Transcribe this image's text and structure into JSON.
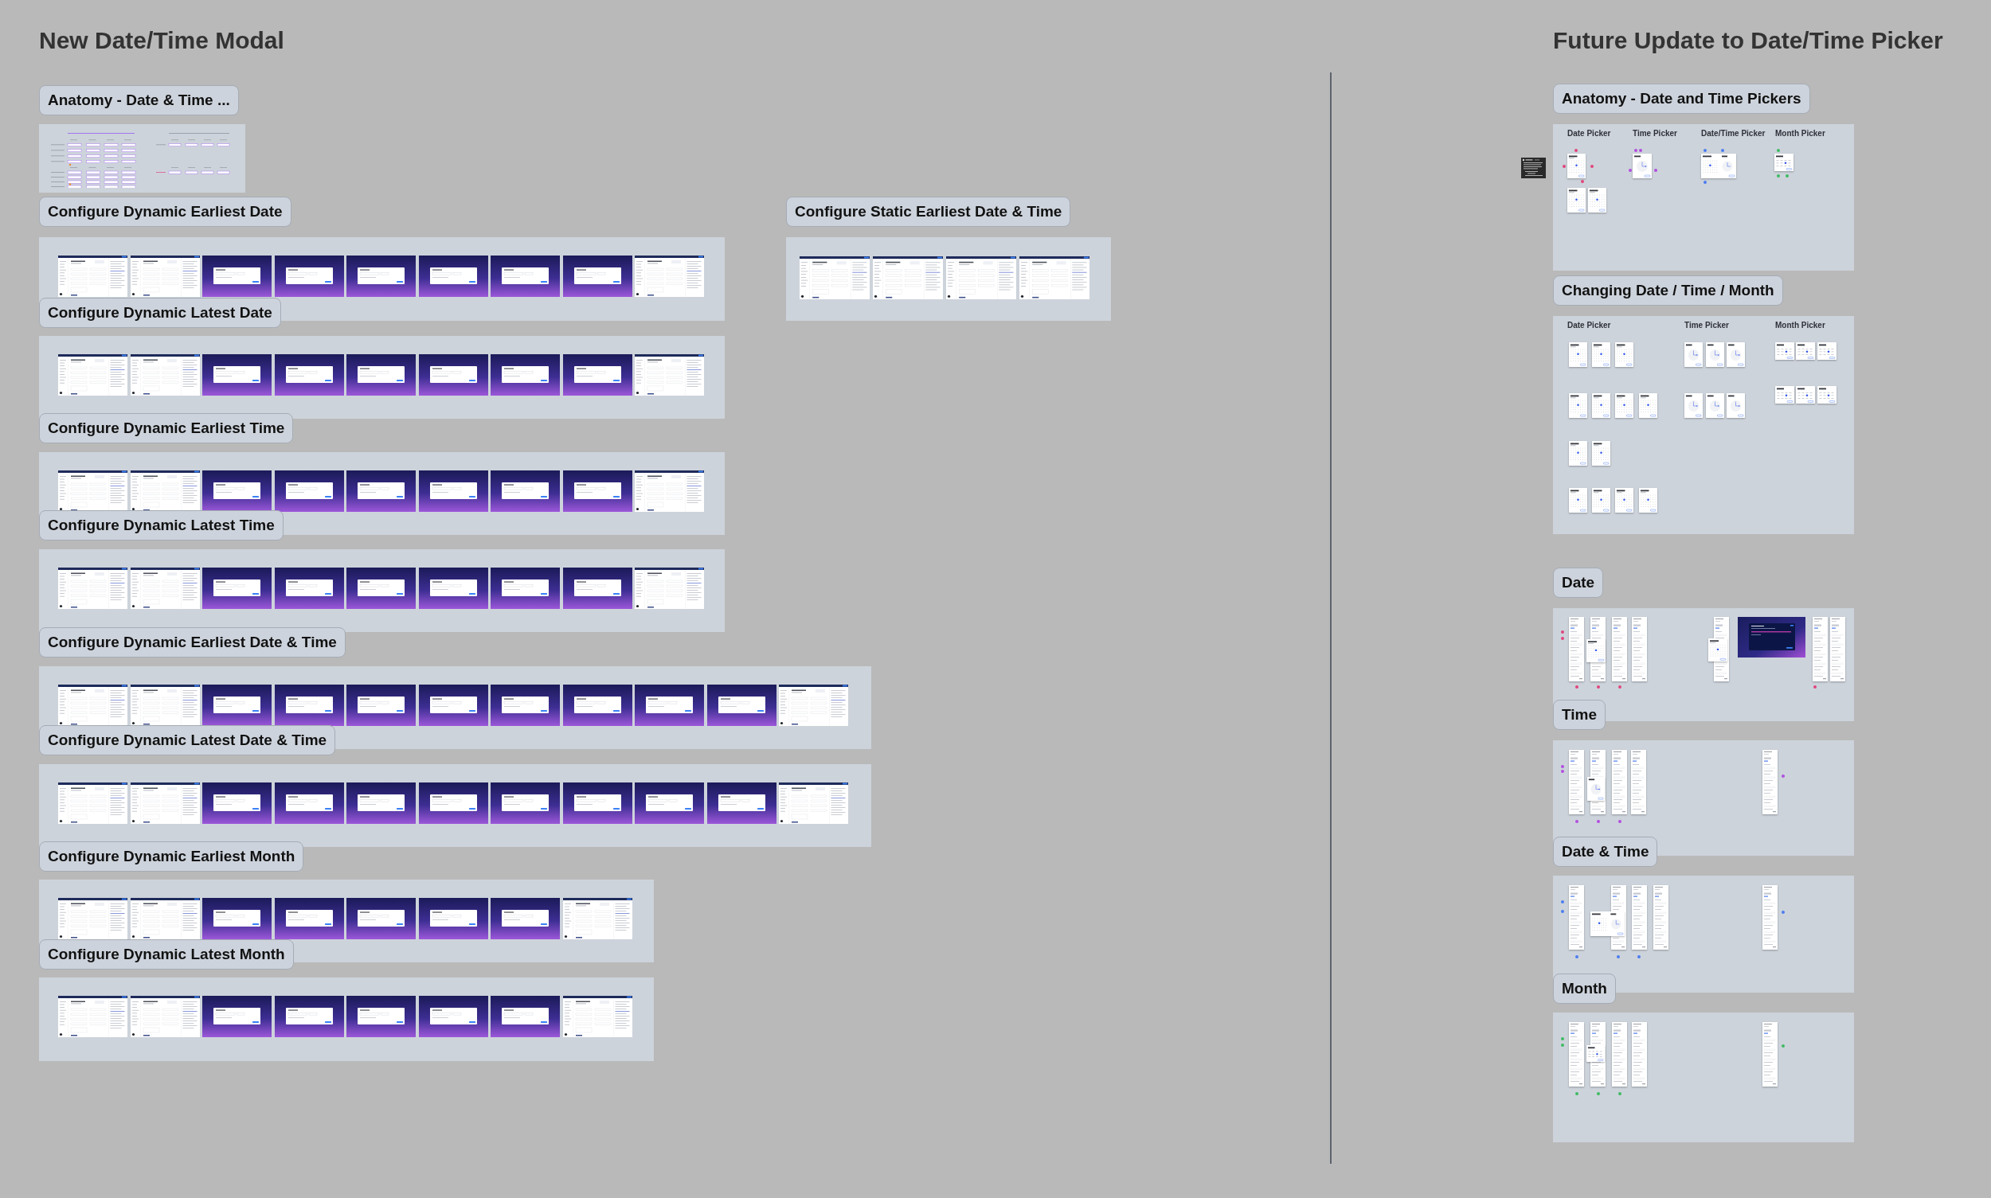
{
  "canvas": {
    "left": {
      "title": "New Date/Time Modal",
      "sections": [
        {
          "label": "Anatomy - Date & Time ...",
          "kind": "anatomy"
        },
        {
          "label": "Configure Dynamic Earliest Date",
          "kind": "screens",
          "screens": [
            {
              "kind": "page"
            },
            {
              "kind": "page"
            },
            {
              "kind": "modal"
            },
            {
              "kind": "modal"
            },
            {
              "kind": "modal"
            },
            {
              "kind": "modal"
            },
            {
              "kind": "modal"
            },
            {
              "kind": "modal"
            },
            {
              "kind": "page"
            }
          ]
        },
        {
          "label": "Configure Dynamic Latest Date",
          "kind": "screens",
          "screens": [
            {
              "kind": "page"
            },
            {
              "kind": "page"
            },
            {
              "kind": "modal"
            },
            {
              "kind": "modal"
            },
            {
              "kind": "modal"
            },
            {
              "kind": "modal"
            },
            {
              "kind": "modal"
            },
            {
              "kind": "modal"
            },
            {
              "kind": "page"
            }
          ]
        },
        {
          "label": "Configure Dynamic Earliest Time",
          "kind": "screens",
          "screens": [
            {
              "kind": "page"
            },
            {
              "kind": "page"
            },
            {
              "kind": "modal"
            },
            {
              "kind": "modal"
            },
            {
              "kind": "modal"
            },
            {
              "kind": "modal"
            },
            {
              "kind": "modal"
            },
            {
              "kind": "modal"
            },
            {
              "kind": "page"
            }
          ]
        },
        {
          "label": "Configure Dynamic Latest Time",
          "kind": "screens",
          "screens": [
            {
              "kind": "page"
            },
            {
              "kind": "page"
            },
            {
              "kind": "modal"
            },
            {
              "kind": "modal"
            },
            {
              "kind": "modal"
            },
            {
              "kind": "modal"
            },
            {
              "kind": "modal"
            },
            {
              "kind": "modal"
            },
            {
              "kind": "page"
            }
          ]
        },
        {
          "label": "Configure Dynamic Earliest Date & Time",
          "kind": "screens",
          "screens": [
            {
              "kind": "page"
            },
            {
              "kind": "page"
            },
            {
              "kind": "modal"
            },
            {
              "kind": "modal"
            },
            {
              "kind": "modal"
            },
            {
              "kind": "modal"
            },
            {
              "kind": "modal"
            },
            {
              "kind": "modal"
            },
            {
              "kind": "modal"
            },
            {
              "kind": "modal"
            },
            {
              "kind": "page"
            }
          ]
        },
        {
          "label": "Configure Dynamic Latest Date & Time",
          "kind": "screens",
          "screens": [
            {
              "kind": "page"
            },
            {
              "kind": "page"
            },
            {
              "kind": "modal"
            },
            {
              "kind": "modal"
            },
            {
              "kind": "modal"
            },
            {
              "kind": "modal"
            },
            {
              "kind": "modal"
            },
            {
              "kind": "modal"
            },
            {
              "kind": "modal"
            },
            {
              "kind": "modal"
            },
            {
              "kind": "page"
            }
          ]
        },
        {
          "label": "Configure Dynamic Earliest Month",
          "kind": "screens",
          "screens": [
            {
              "kind": "page"
            },
            {
              "kind": "page"
            },
            {
              "kind": "modal"
            },
            {
              "kind": "modal"
            },
            {
              "kind": "modal"
            },
            {
              "kind": "modal"
            },
            {
              "kind": "modal"
            },
            {
              "kind": "page"
            }
          ]
        },
        {
          "label": "Configure Dynamic Latest Month",
          "kind": "screens",
          "screens": [
            {
              "kind": "page"
            },
            {
              "kind": "page"
            },
            {
              "kind": "modal"
            },
            {
              "kind": "modal"
            },
            {
              "kind": "modal"
            },
            {
              "kind": "modal"
            },
            {
              "kind": "modal"
            },
            {
              "kind": "page"
            }
          ]
        },
        {
          "label": "Configure Static Earliest Date & Time",
          "kind": "screens",
          "screens": [
            {
              "kind": "page"
            },
            {
              "kind": "page"
            },
            {
              "kind": "page"
            },
            {
              "kind": "page"
            }
          ]
        }
      ]
    },
    "right": {
      "title": "Future Update to Date/Time Picker",
      "sections": [
        {
          "label": "Anatomy - Date and Time Pickers",
          "kind": "picker-anatomy",
          "headings": [
            {
              "text": "Date Picker",
              "color": "#e0467c"
            },
            {
              "text": "Time Picker",
              "color": "#b04ee0"
            },
            {
              "text": "Date/Time Picker",
              "color": "#4b7df0"
            },
            {
              "text": "Month Picker",
              "color": "#3dbb63"
            }
          ]
        },
        {
          "label": "Changing Date / Time / Month",
          "kind": "picker-changes",
          "headings": [
            "Date Picker",
            "Time Picker",
            "Month Picker"
          ]
        },
        {
          "label": "Date",
          "kind": "settings-flow",
          "color": "#e0467c"
        },
        {
          "label": "Time",
          "kind": "settings-flow",
          "color": "#b04ee0"
        },
        {
          "label": "Date & Time",
          "kind": "settings-flow",
          "color": "#4b7df0"
        },
        {
          "label": "Month",
          "kind": "settings-flow",
          "color": "#3dbb63"
        }
      ]
    }
  }
}
